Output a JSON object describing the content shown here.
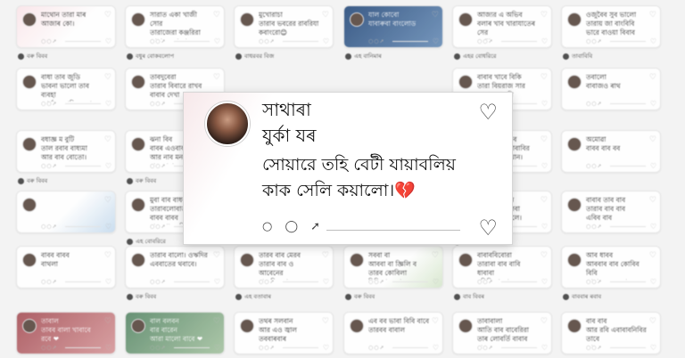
{
  "background_cards": [
    {
      "text": "মাথোন তারা মাৰ\nআজাৰ কো।",
      "style": "pink",
      "label": "বৰু বিবব"
    },
    {
      "text": "সারাত একা খাজী সোর\nতারাজেরা কঞ্জরিরা\nতারাব বৃদ্ধারো আসায়ো\nরবধানর",
      "style": "",
      "label": "বধুৰ বোকবলোপ"
    },
    {
      "text": "মুখোরাচা\nতারাব ভবরের রাবরিযা\nকবাংরো😊",
      "style": "",
      "label": "বাধরবর বিজ"
    },
    {
      "text": "যাল কোবো\nযাবাৰুবা বাংলোড",
      "style": "blue",
      "label": "এহ বানিমাৰ"
    },
    {
      "text": "আজ্যর এ অভিব\nবলাৰ খাব খারাযাতেৰ সের\nভধো।",
      "style": "",
      "label": "এহর বোধরিরে"
    },
    {
      "text": "ওজুবৈব সুব ভালো\nতারায় জা বাংবিবি\nভারে বাওয়া বিবাব",
      "style": "",
      "label": "তাবাবিবি"
    },
    {
      "text": "বাধা তাব জুডি\nভাবনা ভালো তাব ব্যবহা\nআৰ্বাৰ সোনি বজো রবব।",
      "style": "",
      "label": ""
    },
    {
      "text": "তাবদুবেরা\nতারাব বিবারে রাখব\nবাবাব দেখা",
      "style": "",
      "label": ""
    },
    {
      "text": "বাবাব খাবে বিকি\nতারা বিয়রাজ সার\nলাবার সাবাবি",
      "style": "",
      "label": ""
    },
    {
      "text": "তবালো\nবাবাজও ৰাথ",
      "style": "",
      "label": ""
    },
    {
      "text": "বধাজ্ঞ ম বুটি\nতাল রবাব বাধ্যমা\nআর বাব বোতো।",
      "style": "",
      "label": "বৰু বিবব"
    },
    {
      "text": "ঝনা বিব\nবাবৰ এওবাকবরে\nআর নাব মনব\nবাত বাবা ❤",
      "style": "",
      "label": "বৰু বিবব"
    },
    {
      "text": "আৰু বাবব বাব\nজনৰ বাবব খাবাবির\nএব কাবারব খান।",
      "style": "",
      "label": ""
    },
    {
      "text": "অমোৱা\nবাবব বাব বব",
      "style": "",
      "label": ""
    },
    {
      "text": "",
      "style": "sky",
      "label": ""
    },
    {
      "text": "মুবা বাব বাধবা\nতারাবলোবাত নিলির\nবাবব বাবব\nবাজ পাল. বিলের",
      "style": "",
      "label": "এহ বোবরিরে"
    },
    {
      "text": "বনজ্ঞবাব সনে\nএবাবাক তালিবা\nকলার যাই মালে।",
      "style": "",
      "label": "বৰু বিবব"
    },
    {
      "text": "বাবাব তাব বাব\nতারাব বাব বাব\nএবিব বাব",
      "style": "",
      "label": ""
    },
    {
      "text": "বাবব বাবব\nবাথলা",
      "style": "",
      "label": ""
    },
    {
      "text": "তারাব বালো। ওঋদির\nএববাতের থবাবে।",
      "style": "",
      "label": "বৰু বিবব"
    },
    {
      "text": "তারব বাব মেরব\nতারাব বাব ও আবেনের\nবাব্বনিয় বাজন\nবারে❤",
      "style": "",
      "label": "এহ বতাবাৰ"
    },
    {
      "text": "সববা বা\nআববা বা জ্ঞিলি ব\nতারব কোবিলা\nবিবি বাবে বাবে",
      "style": "leaf",
      "label": "বৰু বিবব"
    },
    {
      "text": "বাবাববিবোরা\nতারাবা বাব বাবি ধাবাবা\nমনিলিসা তান তোবগাবেন।",
      "style": "",
      "label": "বাব বিবৰ"
    },
    {
      "text": "আব ধাবব\nআববাব বাব কোবিব বিবি\nলাবারে ববে জাবে।",
      "style": "",
      "label": "বাববাৰ ৰবাব"
    },
    {
      "text": "তাবাল\nতাবব বালা খাবাবে\nরবে ❤",
      "style": "rose",
      "label": "বতাৰাৰ"
    },
    {
      "text": "বাল বলবন\nবার বারেন\nআরা মালো বাবে ❤",
      "style": "green",
      "label": "বৰু বিবব"
    },
    {
      "text": "তথৰ সলবান\nআর এও জ্বাল\nতববাৰবাৰ",
      "style": "",
      "label": ""
    },
    {
      "text": "এব বব ভাবা বিবি বাবে\nতারবব বাবাল",
      "style": "",
      "label": ""
    },
    {
      "text": "তাবাবালা\nআতি বাব বাবেরিরা\nতাৰ লোবৰ্তি বাবাব\nবাবেব",
      "style": "",
      "label": ""
    },
    {
      "text": "বাব বাব\nআর রবি এবাবাবনিবির তাবে\nতাবে।",
      "style": "",
      "label": ""
    },
    {
      "text": "বারব এজ ব বাবা\nভালো বাব\nআর বাবে ববে।",
      "style": "",
      "label": ""
    },
    {
      "text": "সাব্জা বনিয\nবাবাব বিবাবাঝোলো\nবেধালি ৰবাল",
      "style": "",
      "label": ""
    }
  ],
  "featured": {
    "name": "সাথাৰা\nযুৰ্কা যৰ",
    "message": "সোয়ারে তহি বেটী যায়াবলিয়\nকাক সেলি কয়ালো।",
    "emoji": "💔",
    "actions": "○ ◯ ➚"
  }
}
